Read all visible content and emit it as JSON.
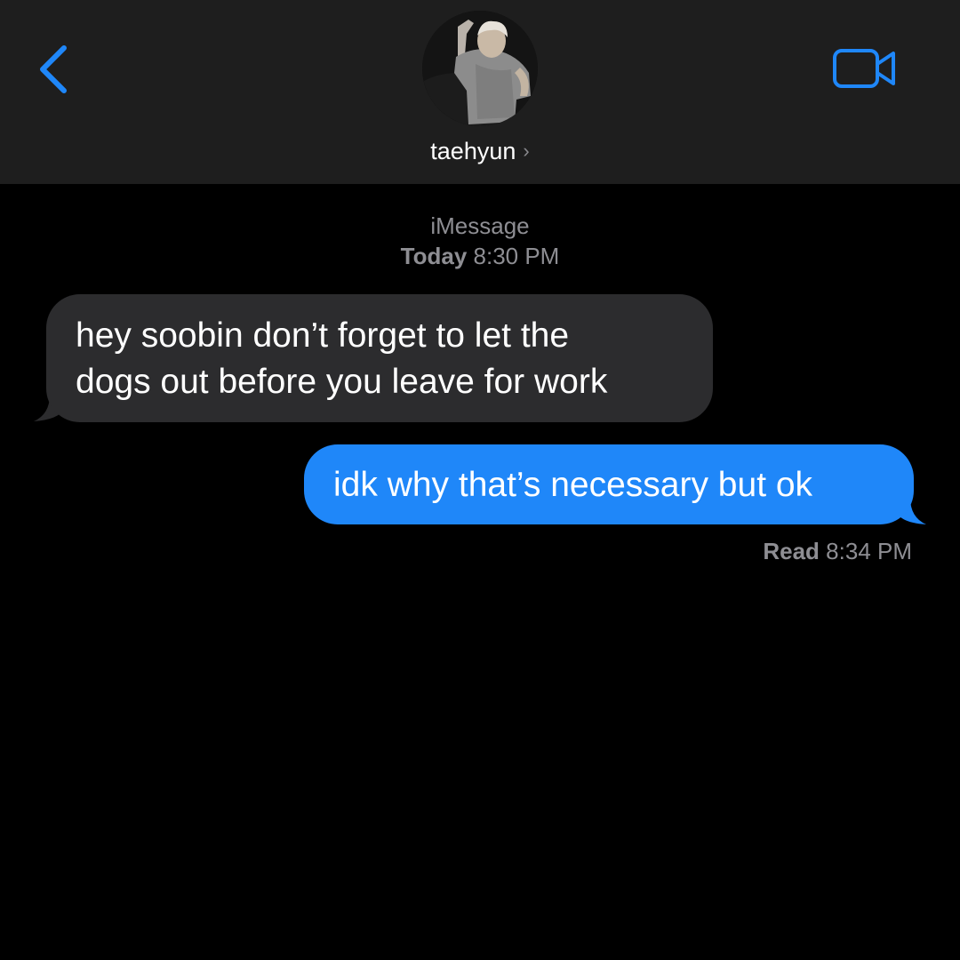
{
  "header": {
    "contact_name": "taehyun",
    "chevron": "›",
    "icons": {
      "back": "chevron-left-icon",
      "video": "video-camera-icon"
    },
    "accent_color": "#1f87f9"
  },
  "thread": {
    "service_label": "iMessage",
    "timestamp_day": "Today",
    "timestamp_time": "8:30 PM"
  },
  "messages": [
    {
      "direction": "received",
      "text": "hey soobin don’t forget to let the\ndogs out before you leave for work",
      "bubble_color": "#2c2c2e"
    },
    {
      "direction": "sent",
      "text": "idk why that’s necessary but ok",
      "bubble_color": "#1f87f9"
    }
  ],
  "receipt": {
    "label": "Read",
    "time": "8:34 PM"
  }
}
